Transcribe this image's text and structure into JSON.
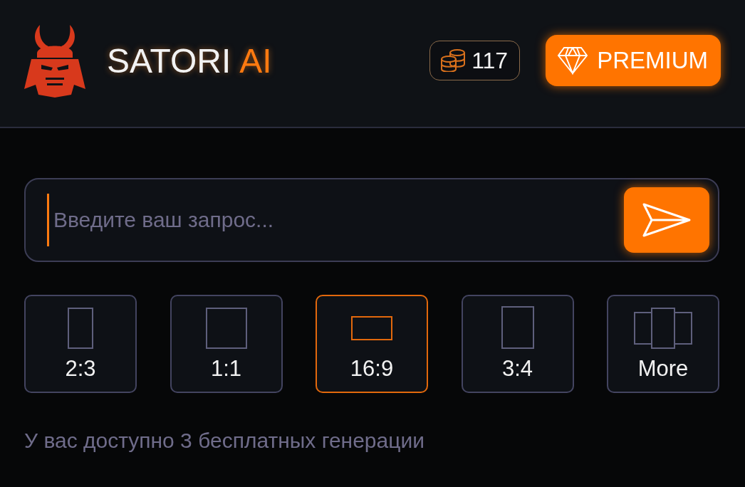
{
  "header": {
    "brand": "SATORI",
    "brand_accent": "AI",
    "coins": "117",
    "premium_button": "PREMIUM"
  },
  "prompt": {
    "placeholder": "Введите ваш запрос..."
  },
  "ratios": [
    {
      "label": "2:3",
      "kind": "portrait",
      "selected": false
    },
    {
      "label": "1:1",
      "kind": "square",
      "selected": false
    },
    {
      "label": "16:9",
      "kind": "landscape",
      "selected": true
    },
    {
      "label": "3:4",
      "kind": "tall",
      "selected": false
    },
    {
      "label": "More",
      "kind": "more",
      "selected": false
    }
  ],
  "note": "У вас доступно 3 бесплатных генерации"
}
